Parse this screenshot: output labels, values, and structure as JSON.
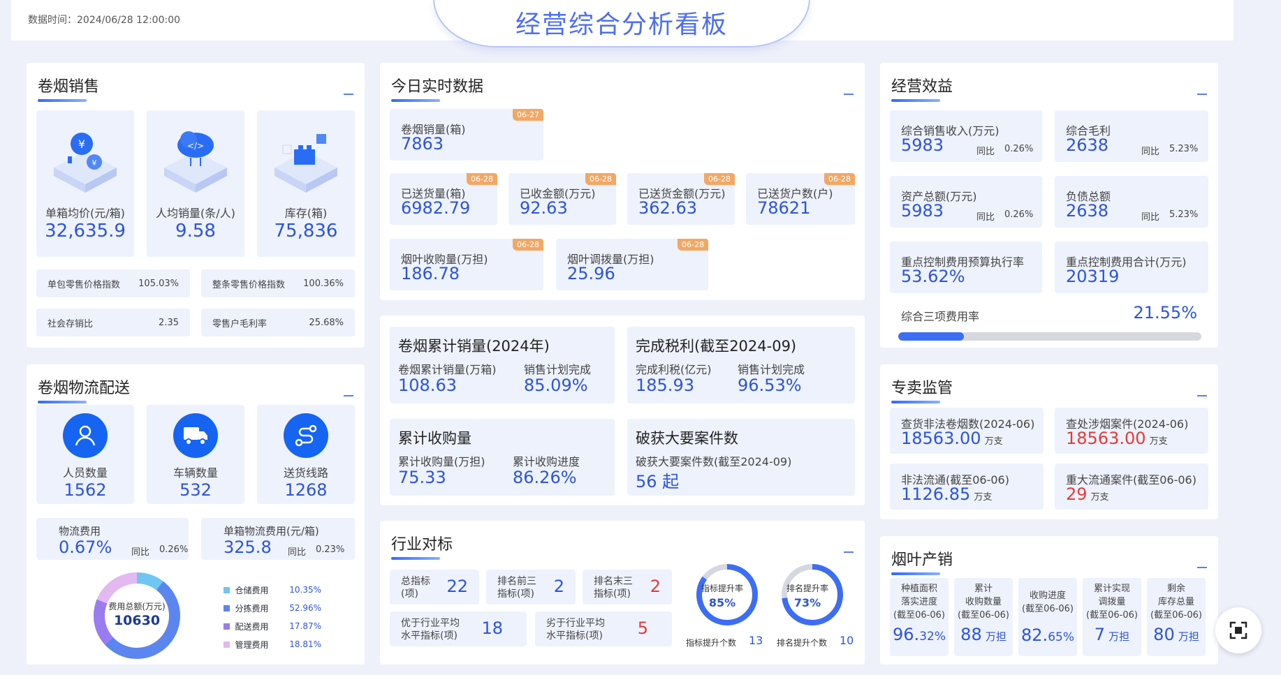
{
  "header": {
    "data_time": "数据时间：2024/06/28  12:00:00",
    "title": "经营综合分析看板"
  },
  "sales": {
    "title": "卷烟销售",
    "stats": [
      {
        "label": "单箱均价(元/箱)",
        "value": "32,635.9",
        "icon": "coin-icon"
      },
      {
        "label": "人均销量(条/人)",
        "value": "9.58",
        "icon": "cloud-icon"
      },
      {
        "label": "库存(箱)",
        "value": "75,836",
        "icon": "blocks-icon"
      }
    ],
    "indexes": [
      {
        "label": "单包零售价格指数",
        "value": "105.03%"
      },
      {
        "label": "整条零售价格指数",
        "value": "100.36%"
      },
      {
        "label": "社会存销比",
        "value": "2.35"
      },
      {
        "label": "零售户毛利率",
        "value": "25.68%"
      }
    ]
  },
  "logistics": {
    "title": "卷烟物流配送",
    "stats": [
      {
        "label": "人员数量",
        "value": "1562",
        "icon": "person-icon"
      },
      {
        "label": "车辆数量",
        "value": "532",
        "icon": "truck-icon"
      },
      {
        "label": "送货线路",
        "value": "1268",
        "icon": "route-icon"
      }
    ],
    "fees": [
      {
        "label": "物流费用",
        "value": "0.67%",
        "yoy_label": "同比",
        "yoy": "0.26%"
      },
      {
        "label": "单箱物流费用(元/箱)",
        "value": "325.8",
        "yoy_label": "同比",
        "yoy": "0.23%"
      }
    ],
    "donut": {
      "center_label": "费用总额(万元)",
      "center_value": "10630",
      "items": [
        {
          "name": "仓储费用",
          "value": 10.35,
          "pct": "10.35%",
          "color": "#6fc6f0"
        },
        {
          "name": "分拣费用",
          "value": 52.96,
          "pct": "52.96%",
          "color": "#5b86f0"
        },
        {
          "name": "配送费用",
          "value": 17.87,
          "pct": "17.87%",
          "color": "#9a7cf0"
        },
        {
          "name": "管理费用",
          "value": 18.81,
          "pct": "18.81%",
          "color": "#e3b9f2"
        }
      ]
    }
  },
  "realtime": {
    "title": "今日实时数据",
    "items": [
      {
        "label": "卷烟销量(箱)",
        "value": "7863",
        "tag": "06-27"
      },
      {
        "label": "已送货量(箱)",
        "value": "6982.79",
        "tag": "06-28"
      },
      {
        "label": "已收金额(万元)",
        "value": "92.63",
        "tag": "06-28"
      },
      {
        "label": "已送货金额(万元)",
        "value": "362.63",
        "tag": "06-28"
      },
      {
        "label": "已送货户数(户)",
        "value": "78621",
        "tag": "06-28"
      },
      {
        "label": "烟叶收购量(万担)",
        "value": "186.78",
        "tag": "06-28"
      },
      {
        "label": "烟叶调拨量(万担)",
        "value": "25.96",
        "tag": "06-28"
      }
    ]
  },
  "cumulative": {
    "blocks": [
      {
        "title": "卷烟累计销量(2024年)",
        "a_label": "卷烟累计销量(万箱)",
        "a_value": "108.63",
        "b_label": "销售计划完成",
        "b_value": "85.09%"
      },
      {
        "title": "完成税利(截至2024-09)",
        "a_label": "完成利税(亿元)",
        "a_value": "185.93",
        "b_label": "销售计划完成",
        "b_value": "96.53%"
      },
      {
        "title": "累计收购量",
        "a_label": "累计收购量(万担)",
        "a_value": "75.33",
        "b_label": "累计收购进度",
        "b_value": "86.26%"
      },
      {
        "title": "破获大要案件数",
        "a_label": "破获大要案件数(截至2024-09)",
        "a_value": "56 起",
        "b_label": "",
        "b_value": ""
      }
    ]
  },
  "industry": {
    "title": "行业对标",
    "items": [
      {
        "label": "总指标\n(项)",
        "value": "22"
      },
      {
        "label": "排名前三\n指标(项)",
        "value": "2"
      },
      {
        "label": "排名末三\n指标(项)",
        "value": "2"
      },
      {
        "label": "优于行业平均\n水平指标(项)",
        "value": "18"
      },
      {
        "label": "劣于行业平均\n水平指标(项)",
        "value": "5"
      }
    ],
    "rings": [
      {
        "title": "指标提升率",
        "pct": "85%",
        "value": 85,
        "foot_label": "指标提升个数",
        "foot_value": "13"
      },
      {
        "title": "排名提升率",
        "pct": "73%",
        "value": 73,
        "foot_label": "排名提升个数",
        "foot_value": "10"
      }
    ]
  },
  "benefit": {
    "title": "经营效益",
    "items": [
      {
        "label": "综合销售收入(万元)",
        "value": "5983",
        "yoy_label": "同比",
        "yoy": "0.26%"
      },
      {
        "label": "综合毛利",
        "value": "2638",
        "yoy_label": "同比",
        "yoy": "5.23%"
      },
      {
        "label": "资产总额(万元)",
        "value": "5983",
        "yoy_label": "同比",
        "yoy": "0.26%"
      },
      {
        "label": "负债总额",
        "value": "2638",
        "yoy_label": "同比",
        "yoy": "5.23%"
      },
      {
        "label": "重点控制费用预算执行率",
        "value": "53.62%",
        "yoy_label": "",
        "yoy": ""
      },
      {
        "label": "重点控制费用合计(万元)",
        "value": "20319",
        "yoy_label": "",
        "yoy": ""
      }
    ],
    "rate_label": "综合三项费用率",
    "rate_value": "21.55%",
    "rate_fraction": 0.2155
  },
  "monopoly": {
    "title": "专卖监管",
    "items": [
      {
        "label": "查货非法卷烟数(2024-06)",
        "value": "18563.00",
        "unit": "万支",
        "alert": false
      },
      {
        "label": "查处涉烟案件(2024-06)",
        "value": "18563.00",
        "unit": "万支",
        "alert": true
      },
      {
        "label": "非法流通(截至06-06)",
        "value": "1126.85",
        "unit": "万支",
        "alert": false
      },
      {
        "label": "重大流通案件(截至06-06)",
        "value": "29",
        "unit": "万支",
        "alert": true
      }
    ]
  },
  "leaf": {
    "title": "烟叶产销",
    "items": [
      {
        "label": "种植面积\n落实进度\n(截至06-06)",
        "value": "96.",
        "value2": "32%"
      },
      {
        "label": "累计\n收购数量\n(截至06-06)",
        "value": "88",
        "value2": "万担"
      },
      {
        "label": "收购进度\n(截至06-06)",
        "value": "82.",
        "value2": "65%"
      },
      {
        "label": "累计实现\n调拨量\n(截至06-06)",
        "value": "7",
        "value2": "万担"
      },
      {
        "label": "剩余\n库存总量\n(截至06-06)",
        "value": "80",
        "value2": "万担"
      }
    ]
  }
}
